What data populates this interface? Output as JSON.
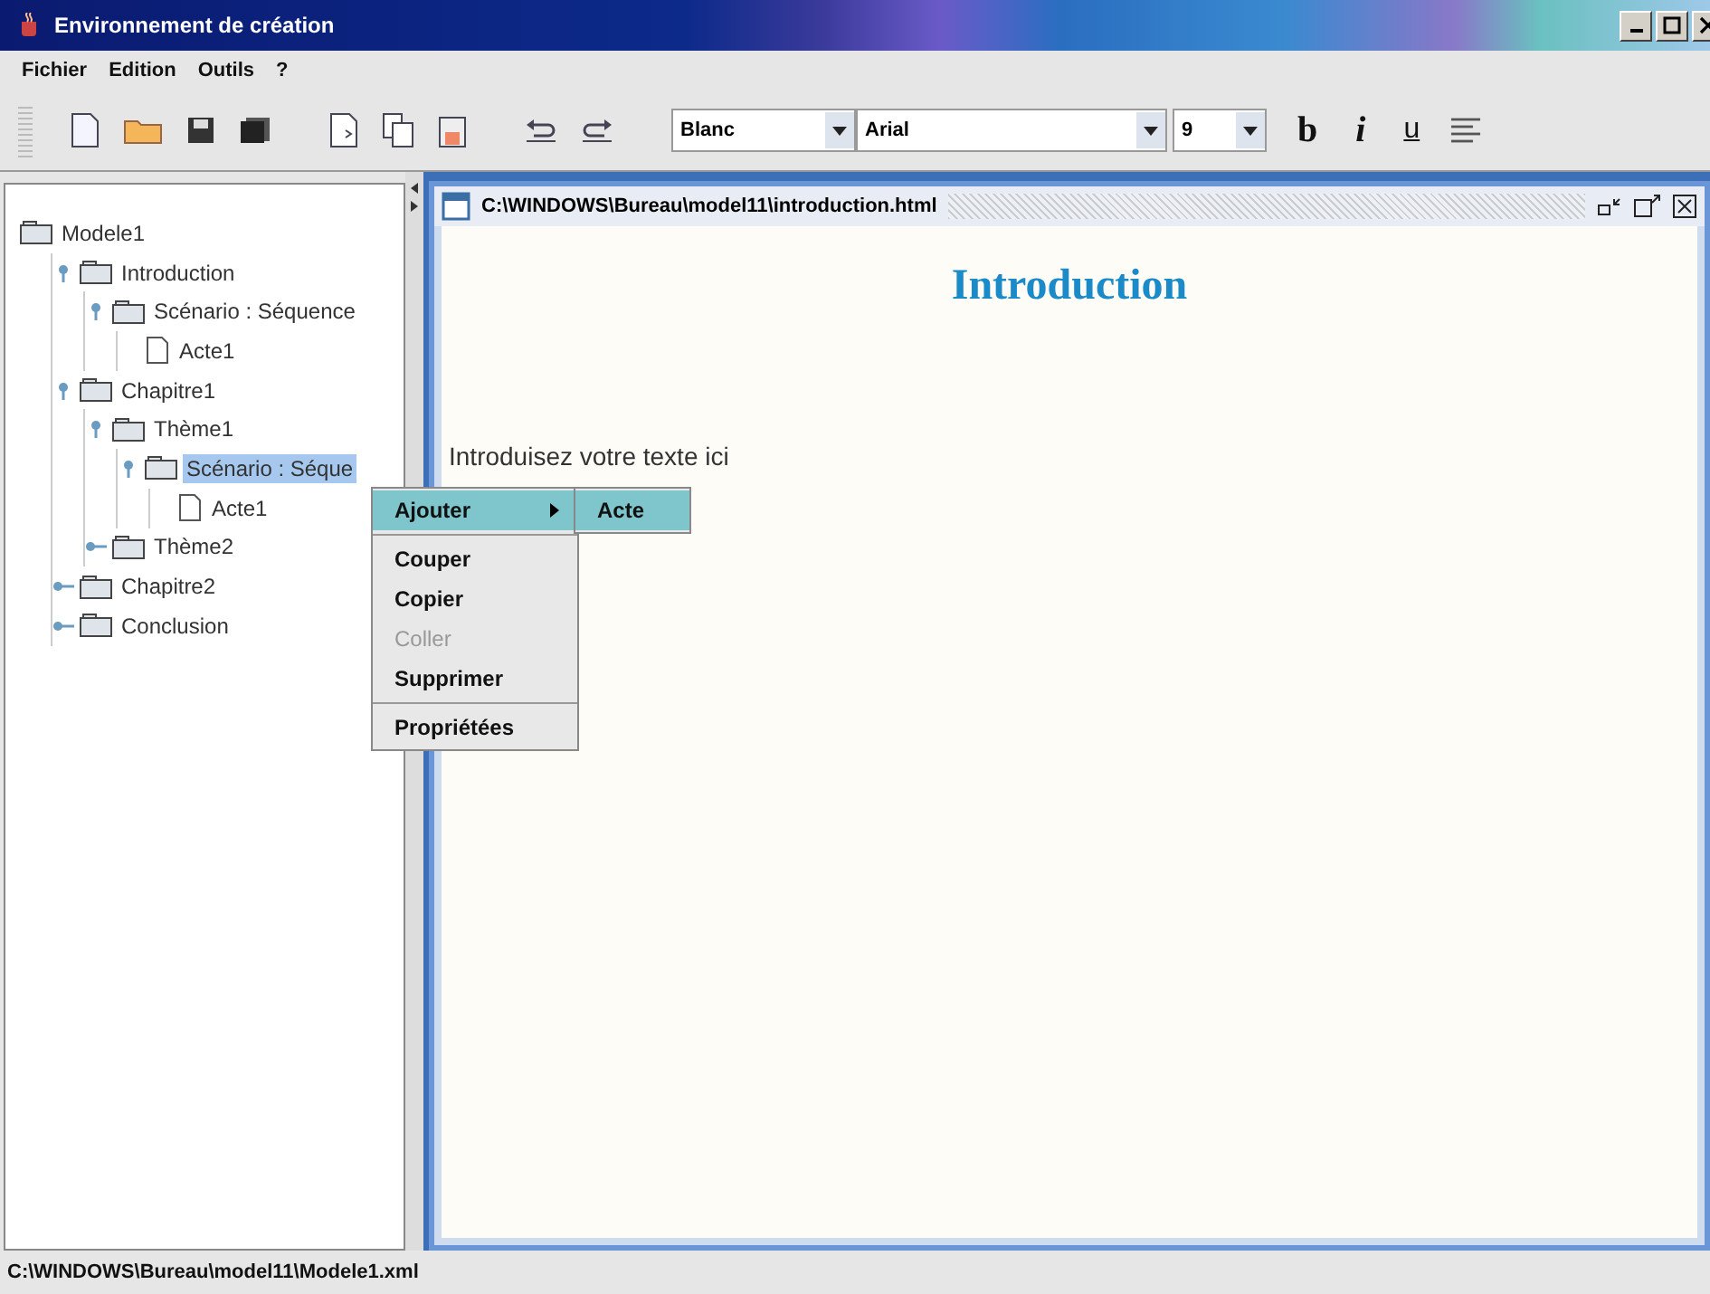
{
  "window": {
    "title": "Environnement de création"
  },
  "menu_bar": [
    "Fichier",
    "Edition",
    "Outils",
    "?"
  ],
  "toolbar": {
    "color_combo": "Blanc",
    "font_combo": "Arial",
    "size_combo": "9",
    "format_buttons": [
      {
        "label": "b",
        "kind": "bold"
      },
      {
        "label": "i",
        "kind": "italic"
      },
      {
        "label": "u",
        "kind": "underline"
      }
    ]
  },
  "tree": [
    {
      "label": "Modele1",
      "kind": "root",
      "selected": false,
      "children": [
        {
          "label": "Introduction",
          "kind": "folder",
          "expanded": true,
          "selected": false,
          "children": [
            {
              "label": "Scénario : Séquence",
              "kind": "folder",
              "expanded": true,
              "selected": false,
              "children": [
                {
                  "label": "Acte1",
                  "kind": "page",
                  "selected": false
                }
              ]
            }
          ]
        },
        {
          "label": "Chapitre1",
          "kind": "folder",
          "expanded": true,
          "selected": false,
          "children": [
            {
              "label": "Thème1",
              "kind": "folder",
              "expanded": true,
              "selected": false,
              "children": [
                {
                  "label": "Scénario : Séque",
                  "kind": "folder",
                  "expanded": true,
                  "selected": true,
                  "children": [
                    {
                      "label": "Acte1",
                      "kind": "page",
                      "selected": false
                    }
                  ]
                }
              ]
            },
            {
              "label": "Thème2",
              "kind": "folder",
              "expanded": false,
              "selected": false
            }
          ]
        },
        {
          "label": "Chapitre2",
          "kind": "folder",
          "expanded": false,
          "selected": false
        },
        {
          "label": "Conclusion",
          "kind": "folder",
          "expanded": false,
          "selected": false
        }
      ]
    }
  ],
  "document": {
    "title": "C:\\WINDOWS\\Bureau\\model11\\introduction.html",
    "heading": "Introduction",
    "body": "Introduisez votre texte ici"
  },
  "context_menu": [
    {
      "label": "Ajouter",
      "kind": "submenu",
      "selected": true,
      "disabled": false
    },
    {
      "kind": "separator"
    },
    {
      "label": "Couper",
      "kind": "item",
      "selected": false,
      "disabled": false
    },
    {
      "label": "Copier",
      "kind": "item",
      "selected": false,
      "disabled": false
    },
    {
      "label": "Coller",
      "kind": "item",
      "selected": false,
      "disabled": true
    },
    {
      "label": "Supprimer",
      "kind": "item",
      "selected": false,
      "disabled": false
    },
    {
      "kind": "separator"
    },
    {
      "label": "Propriétées",
      "kind": "item",
      "selected": false,
      "disabled": false
    }
  ],
  "submenu": [
    {
      "label": "Acte",
      "selected": true
    }
  ],
  "status_bar": "C:\\WINDOWS\\Bureau\\model11\\Modele1.xml"
}
